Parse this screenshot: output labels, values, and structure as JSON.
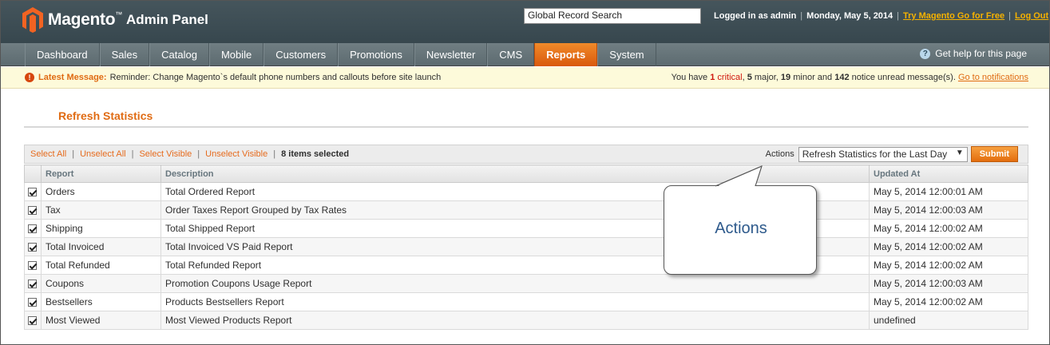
{
  "header": {
    "app_name": "Magento",
    "app_sub": "Admin Panel",
    "tm": "™",
    "search_value": "Global Record Search",
    "logged_in": "Logged in as admin",
    "date": "Monday, May 5, 2014",
    "try_link": "Try Magento Go for Free",
    "logout_link": "Log Out"
  },
  "nav": {
    "items": [
      "Dashboard",
      "Sales",
      "Catalog",
      "Mobile",
      "Customers",
      "Promotions",
      "Newsletter",
      "CMS",
      "Reports",
      "System"
    ],
    "active": "Reports",
    "help": "Get help for this page"
  },
  "message": {
    "latest_label": "Latest Message:",
    "text": "Reminder: Change Magento`s default phone numbers and callouts before site launch",
    "summary_prefix": "You have",
    "critical_count": "1",
    "critical_label": "critical",
    "major_count": "5",
    "major_label": "major,",
    "minor_count": "19",
    "minor_label": "minor and",
    "notice_count": "142",
    "notice_label": "notice unread message(s).",
    "link": "Go to notifications"
  },
  "page": {
    "title": "Refresh Statistics"
  },
  "massaction": {
    "select_all": "Select All",
    "unselect_all": "Unselect All",
    "select_visible": "Select Visible",
    "unselect_visible": "Unselect Visible",
    "selected_count": "8",
    "selected_label": "items selected",
    "actions_label": "Actions",
    "action_value": "Refresh Statistics for the Last Day",
    "submit": "Submit"
  },
  "table": {
    "columns": [
      "Report",
      "Description",
      "Updated At"
    ],
    "rows": [
      {
        "report": "Orders",
        "description": "Total Ordered Report",
        "updated": "May 5, 2014 12:00:01 AM",
        "checked": true
      },
      {
        "report": "Tax",
        "description": "Order Taxes Report Grouped by Tax Rates",
        "updated": "May 5, 2014 12:00:03 AM",
        "checked": true
      },
      {
        "report": "Shipping",
        "description": "Total Shipped Report",
        "updated": "May 5, 2014 12:00:02 AM",
        "checked": true
      },
      {
        "report": "Total Invoiced",
        "description": "Total Invoiced VS Paid Report",
        "updated": "May 5, 2014 12:00:02 AM",
        "checked": true
      },
      {
        "report": "Total Refunded",
        "description": "Total Refunded Report",
        "updated": "May 5, 2014 12:00:02 AM",
        "checked": true
      },
      {
        "report": "Coupons",
        "description": "Promotion Coupons Usage Report",
        "updated": "May 5, 2014 12:00:03 AM",
        "checked": true
      },
      {
        "report": "Bestsellers",
        "description": "Products Bestsellers Report",
        "updated": "May 5, 2014 12:00:02 AM",
        "checked": true
      },
      {
        "report": "Most Viewed",
        "description": "Most Viewed Products Report",
        "updated": "undefined",
        "checked": true
      }
    ]
  },
  "callout": {
    "text": "Actions"
  },
  "colors": {
    "accent": "#e06b13",
    "header_bg": "#3f4f56",
    "nav_active": "#e56f15",
    "message_bg": "#fdfada",
    "callout_text": "#2e5a8c"
  },
  "icons": {
    "logo": "magento-logo-icon",
    "help": "help-icon",
    "message": "alert-icon",
    "checkbox": "checkbox-checked-icon",
    "dropdown": "chevron-down-icon"
  }
}
